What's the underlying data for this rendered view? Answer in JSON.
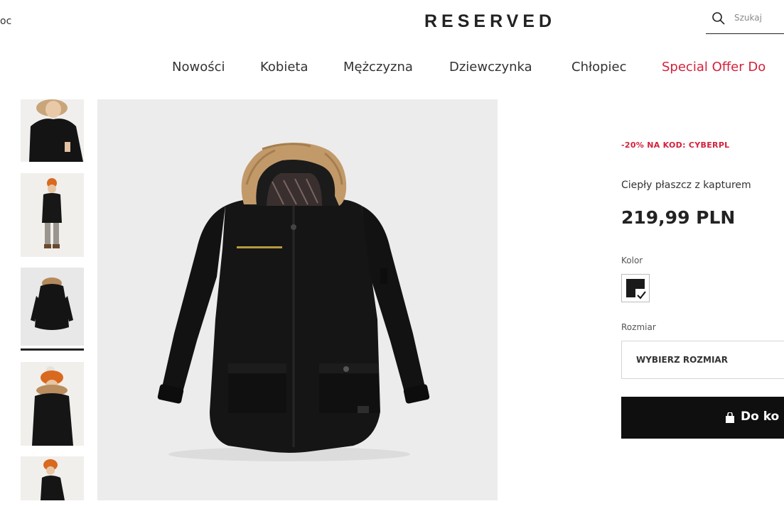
{
  "header": {
    "help_text": "oc",
    "logo": "RESERVED",
    "search_placeholder": "Szukaj"
  },
  "nav": {
    "items": [
      "Nowości",
      "Kobieta",
      "Mężczyzna",
      "Dziewczynka",
      "Chłopiec"
    ],
    "special": "Special Offer Do"
  },
  "gallery": {
    "thumbnail_count": 5,
    "active_thumbnail": 3
  },
  "product": {
    "promo": "-20% NA KOD: CYBERPL",
    "name": "Ciepły płaszcz z kapturem",
    "price": "219,99 PLN",
    "color_label": "Kolor",
    "selected_color": "#1a1a1a",
    "size_label": "Rozmiar",
    "size_placeholder": "WYBIERZ ROZMIAR",
    "cart_button": "Do ko"
  },
  "colors": {
    "accent": "#d4213c",
    "button": "#0f0f0f"
  }
}
